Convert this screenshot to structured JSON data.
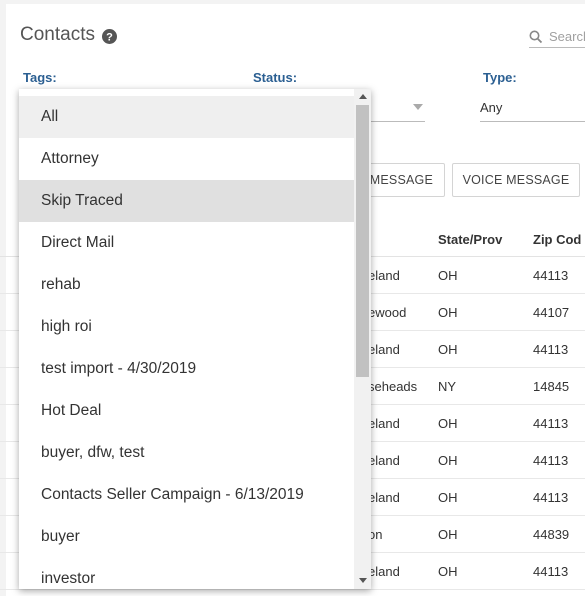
{
  "header": {
    "title": "Contacts"
  },
  "search": {
    "placeholder": "Search"
  },
  "filters": {
    "tags_label": "Tags:",
    "status_label": "Status:",
    "type_label": "Type:",
    "type_value": "Any"
  },
  "actions": {
    "text_message_label": "MESSAGE",
    "voice_message_label": "VOICE MESSAGE"
  },
  "table": {
    "headers": {
      "state": "State/Prov",
      "zip": "Zip Cod"
    },
    "rows": [
      {
        "city": "eland",
        "state": "OH",
        "zip": "44113"
      },
      {
        "city": "ewood",
        "state": "OH",
        "zip": "44107"
      },
      {
        "city": "eland",
        "state": "OH",
        "zip": "44113"
      },
      {
        "city": "seheads",
        "state": "NY",
        "zip": "14845"
      },
      {
        "city": "eland",
        "state": "OH",
        "zip": "44113"
      },
      {
        "city": "eland",
        "state": "OH",
        "zip": "44113"
      },
      {
        "city": "eland",
        "state": "OH",
        "zip": "44113"
      },
      {
        "city": "on",
        "state": "OH",
        "zip": "44839"
      },
      {
        "city": "eland",
        "state": "OH",
        "zip": "44113"
      }
    ]
  },
  "tags_dropdown": {
    "options": [
      "All",
      "Attorney",
      "Skip Traced",
      "Direct Mail",
      "rehab",
      "high roi",
      "test import - 4/30/2019",
      "Hot Deal",
      "buyer, dfw, test",
      "Contacts Seller Campaign - 6/13/2019",
      "buyer",
      "investor"
    ],
    "highlighted": "Skip Traced"
  },
  "colors": {
    "label_blue": "#2b5f92",
    "highlight_gray": "#e0e0e0",
    "scrollbar_thumb": "#c1c1c1"
  },
  "icons": {
    "help": "question-circle-icon",
    "search": "search-icon"
  }
}
